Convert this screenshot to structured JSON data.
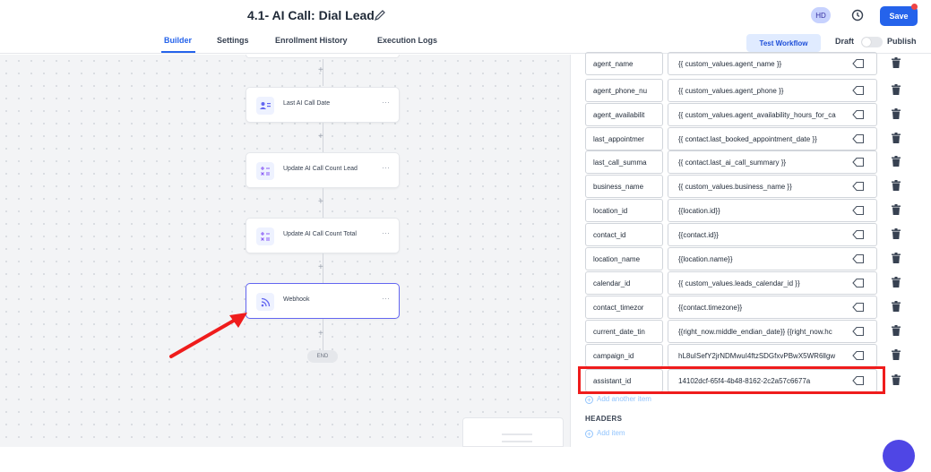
{
  "header": {
    "title": "4.1- AI Call: Dial Lead",
    "avatar_initials": "HD",
    "save_label": "Save",
    "accent_color": "#2563eb"
  },
  "tabs": {
    "items": [
      {
        "label": "Builder",
        "active": true
      },
      {
        "label": "Settings",
        "active": false
      },
      {
        "label": "Enrollment History",
        "active": false
      },
      {
        "label": "Execution Logs",
        "active": false
      }
    ],
    "test_workflow_label": "Test Workflow",
    "draft_label": "Draft",
    "publish_label": "Publish",
    "published": false
  },
  "workflow": {
    "nodes": [
      {
        "label": "Last AI Call Date",
        "icon": "user-list-icon"
      },
      {
        "label": "Update AI Call Count Lead",
        "icon": "math-operators-icon"
      },
      {
        "label": "Update AI Call Count Total",
        "icon": "math-operators-icon"
      },
      {
        "label": "Webhook",
        "icon": "webhook-icon",
        "selected": true
      }
    ],
    "menu_glyph": "···",
    "plus_glyph": "+",
    "end_label": "END"
  },
  "webhook_panel": {
    "rows": [
      {
        "key": "agent_name",
        "value": "{{ custom_values.agent_name }}"
      },
      {
        "key": "agent_phone_nu",
        "value": "{{ custom_values.agent_phone }}"
      },
      {
        "key": "agent_availabilit",
        "value": "{{ custom_values.agent_availability_hours_for_ca"
      },
      {
        "key": "last_appointmer",
        "value": "{{ contact.last_booked_appointment_date }}"
      },
      {
        "key": "last_call_summa",
        "value": "{{ contact.last_ai_call_summary }}"
      },
      {
        "key": "business_name",
        "value": "{{ custom_values.business_name }}"
      },
      {
        "key": "location_id",
        "value": "{{location.id}}"
      },
      {
        "key": "contact_id",
        "value": "{{contact.id}}"
      },
      {
        "key": "location_name",
        "value": "{{location.name}}"
      },
      {
        "key": "calendar_id",
        "value": "{{ custom_values.leads_calendar_id }}"
      },
      {
        "key": "contact_timezor",
        "value": "{{contact.timezone}}"
      },
      {
        "key": "current_date_tin",
        "value": "{{right_now.middle_endian_date}} {{right_now.hc"
      },
      {
        "key": "campaign_id",
        "value": "hL8uISefY2jrNDMwuI4ftzSDGfxvPBwX5WR6llgw"
      },
      {
        "key": "assistant_id",
        "value": "14102dcf-65f4-4b48-8162-2c2a57c6677a",
        "highlighted": true
      }
    ],
    "add_another_label": "Add another item",
    "headers_label": "HEADERS",
    "add_item_label": "Add item",
    "highlight_color": "#ef1c1c"
  }
}
